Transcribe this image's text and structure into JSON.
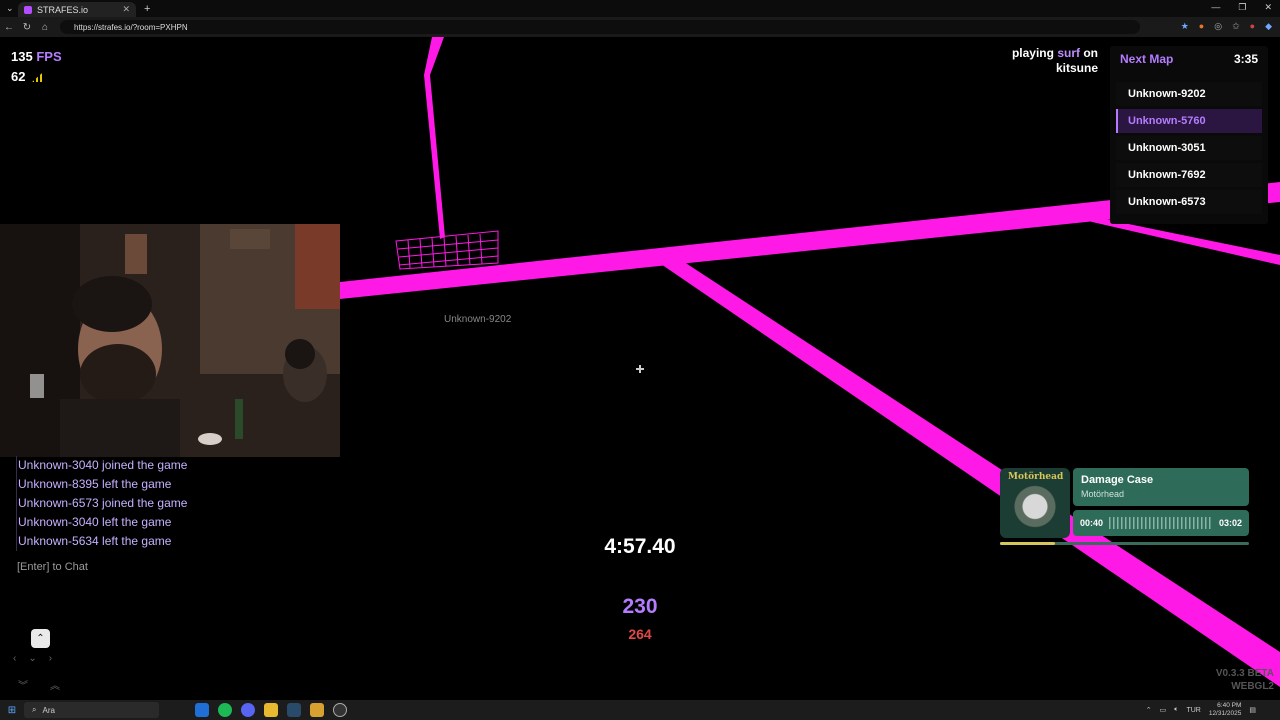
{
  "browser": {
    "tab_title": "STRAFES.io",
    "url": "https://strafes.io/?room=PXHPN"
  },
  "hud": {
    "fps_value": "135",
    "fps_unit": "FPS",
    "ping_value": "62",
    "playing_prefix": "playing",
    "playing_mode": "surf",
    "playing_on": "on",
    "playing_map": "kitsune",
    "next_map_label": "Next Map",
    "next_map_time": "3:35",
    "maps": [
      {
        "name": "Unknown-9202",
        "active": false
      },
      {
        "name": "Unknown-5760",
        "active": true
      },
      {
        "name": "Unknown-3051",
        "active": false
      },
      {
        "name": "Unknown-7692",
        "active": false
      },
      {
        "name": "Unknown-6573",
        "active": false
      }
    ],
    "player_tag": "Unknown-9202",
    "feed": [
      "Unknown-3040 joined the game",
      "Unknown-8395 left the game",
      "Unknown-6573 joined the game",
      "Unknown-3040 left the game",
      "Unknown-5634 left the game"
    ],
    "chat_hint": "[Enter] to Chat",
    "timer": "4:57.40",
    "speed": "230",
    "max_speed": "264",
    "version": "V0.3.3 BETA",
    "renderer": "WEBGL2"
  },
  "music": {
    "title": "Damage Case",
    "artist": "Motörhead",
    "album_art_text": "Motörhead",
    "elapsed": "00:40",
    "duration": "03:02",
    "progress": 0.22
  },
  "taskbar": {
    "search_placeholder": "Ara",
    "lang": "TUR",
    "time": "6:40 PM",
    "date": "12/31/2025"
  },
  "colors": {
    "accent_purple": "#b57cff",
    "track_magenta": "#ff19e6",
    "music_green": "#2e6b58",
    "max_speed_red": "#e04848"
  }
}
